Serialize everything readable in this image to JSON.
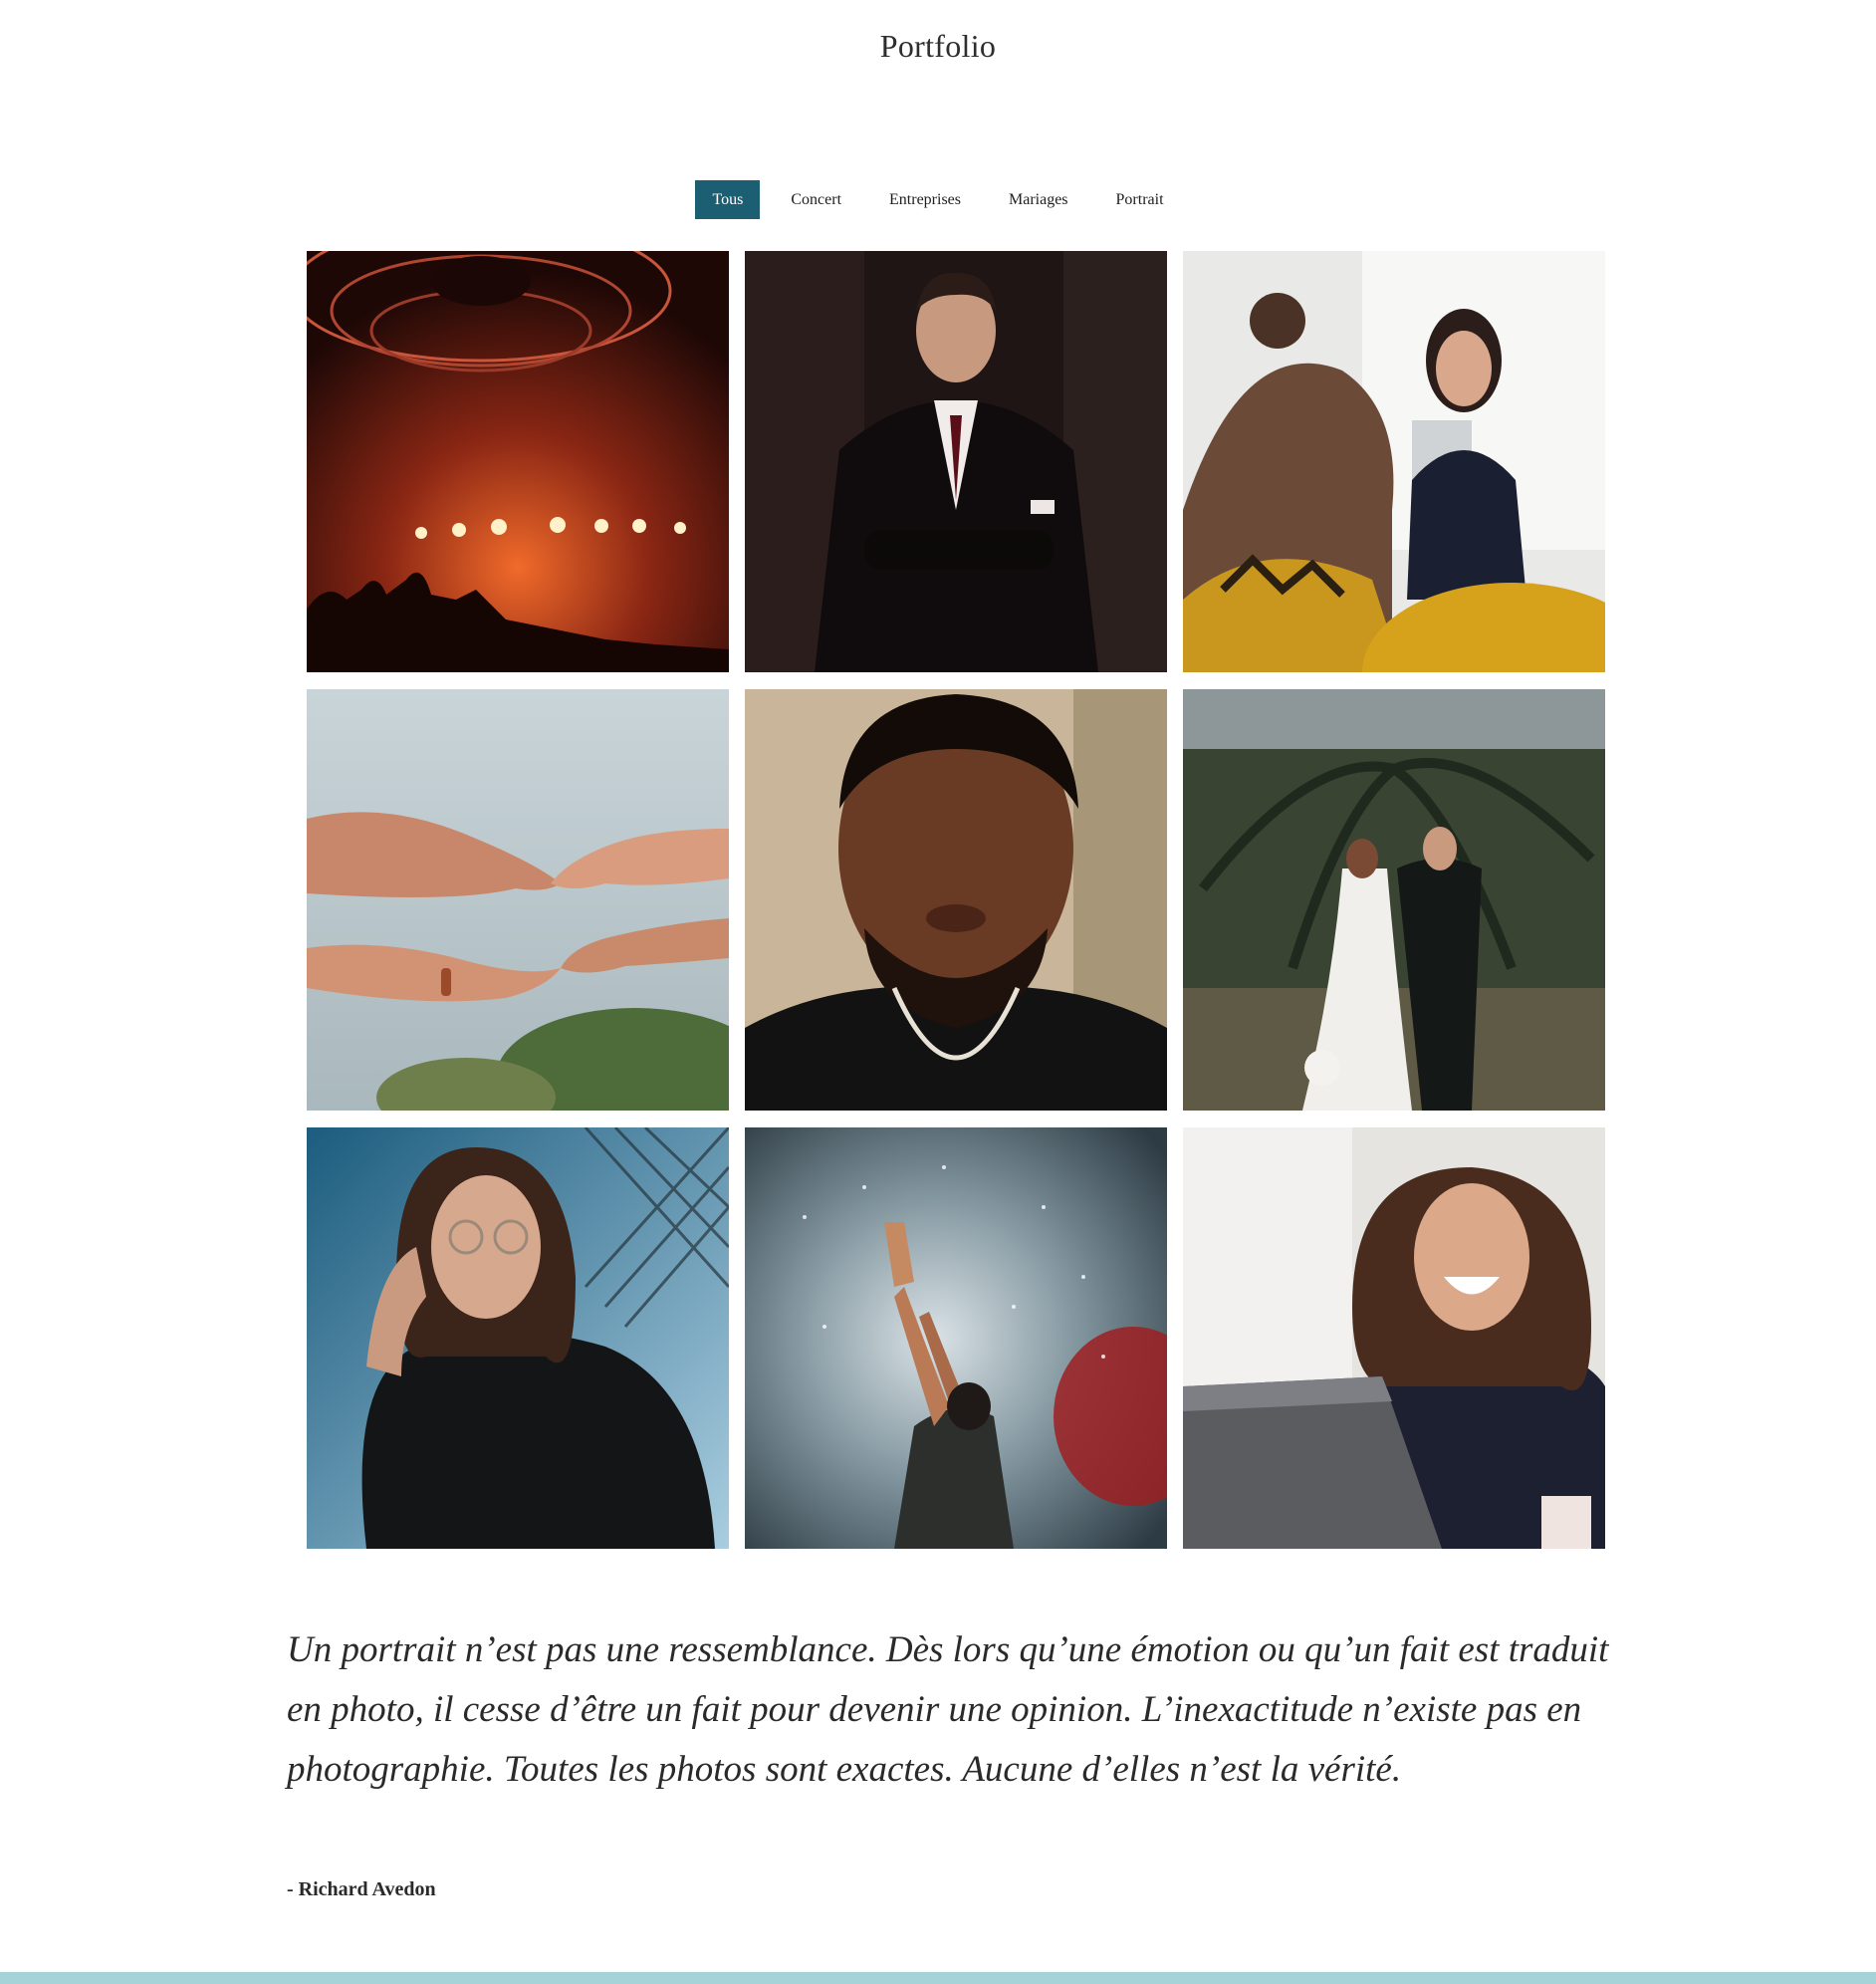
{
  "header": {
    "title": "Portfolio"
  },
  "filters": [
    {
      "label": "Tous",
      "active": true
    },
    {
      "label": "Concert",
      "active": false
    },
    {
      "label": "Entreprises",
      "active": false
    },
    {
      "label": "Mariages",
      "active": false
    },
    {
      "label": "Portrait",
      "active": false
    }
  ],
  "gallery": {
    "photos": [
      {
        "subject": "concert-stage-photo"
      },
      {
        "subject": "businessman-portrait-photo"
      },
      {
        "subject": "office-meeting-photo"
      },
      {
        "subject": "wedding-hands-photo"
      },
      {
        "subject": "man-portrait-photo"
      },
      {
        "subject": "wedding-couple-photo"
      },
      {
        "subject": "woman-glasses-portrait-photo"
      },
      {
        "subject": "concert-performer-photo"
      },
      {
        "subject": "laughing-woman-laptop-photo"
      }
    ]
  },
  "quote": {
    "text": "Un portrait n’est pas une ressemblance. Dès lors qu’une émotion ou qu’un fait est traduit en photo, il cesse d’être un fait pour devenir une opinion. L’inexactitude n’existe pas en photographie. Toutes les photos sont exactes. Aucune d’elles n’est la vérité.",
    "author": "- Richard Avedon"
  },
  "colors": {
    "accent": "#1c5f73",
    "footer": "#a6d3d8"
  }
}
